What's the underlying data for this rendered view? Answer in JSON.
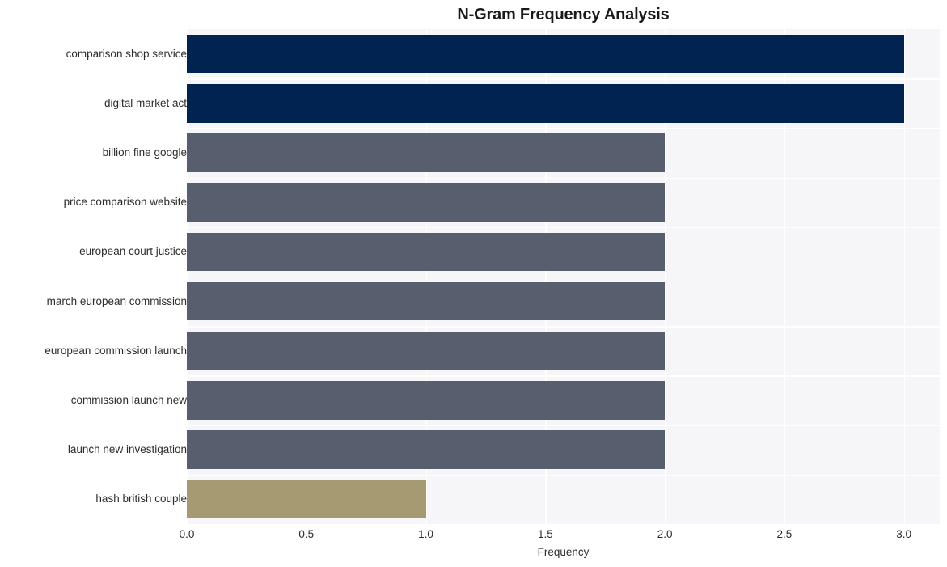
{
  "chart_data": {
    "type": "bar",
    "orientation": "horizontal",
    "title": "N-Gram Frequency Analysis",
    "xlabel": "Frequency",
    "ylabel": "",
    "xlim": [
      0.0,
      3.15
    ],
    "xticks": [
      "0.0",
      "0.5",
      "1.0",
      "1.5",
      "2.0",
      "2.5",
      "3.0"
    ],
    "xtick_values": [
      0.0,
      0.5,
      1.0,
      1.5,
      2.0,
      2.5,
      3.0
    ],
    "grid": true,
    "legend": "none",
    "categories": [
      "comparison shop service",
      "digital market act",
      "billion fine google",
      "price comparison website",
      "european court justice",
      "march european commission",
      "european commission launch",
      "commission launch new",
      "launch new investigation",
      "hash british couple"
    ],
    "values": [
      3,
      3,
      2,
      2,
      2,
      2,
      2,
      2,
      2,
      1
    ],
    "bar_colors": [
      "#00244f",
      "#00244f",
      "#575e6e",
      "#575e6e",
      "#575e6e",
      "#575e6e",
      "#575e6e",
      "#575e6e",
      "#575e6e",
      "#a59a72"
    ]
  },
  "style": {
    "figure_background": "#ffffff",
    "plot_background": "#f6f6f8",
    "grid_color": "#ffffff",
    "text_color": "#2c2c2c",
    "title_color": "#1a1a1a"
  }
}
